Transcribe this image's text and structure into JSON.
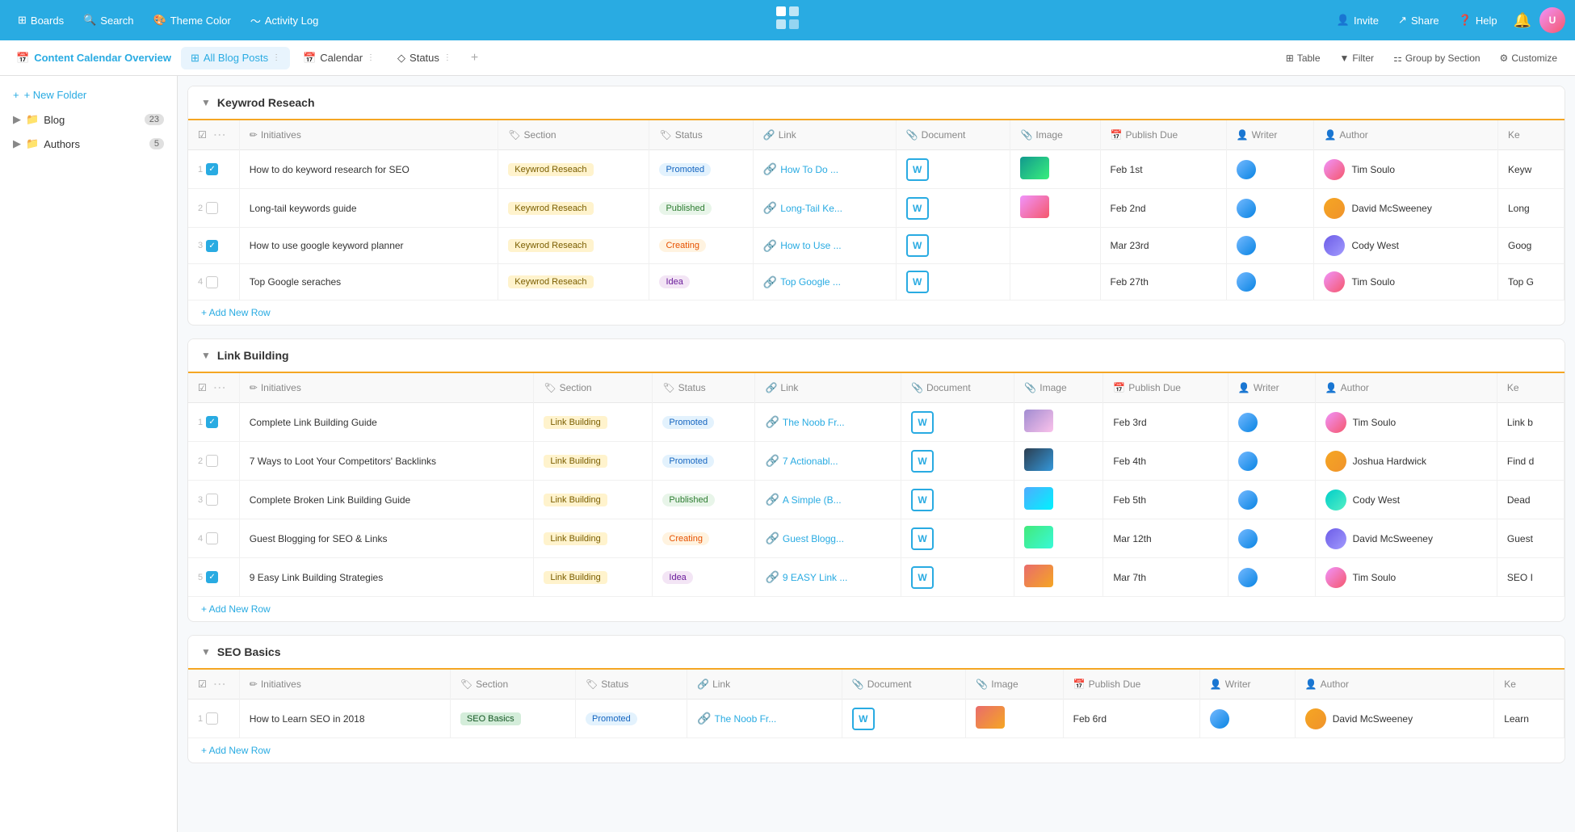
{
  "nav": {
    "boards_label": "Boards",
    "search_label": "Search",
    "theme_label": "Theme Color",
    "activity_label": "Activity Log",
    "invite_label": "Invite",
    "share_label": "Share",
    "help_label": "Help",
    "logo": "⊞"
  },
  "second_nav": {
    "page_title": "Content Calendar Overview",
    "tabs": [
      {
        "label": "All Blog Posts",
        "active": true
      },
      {
        "label": "Calendar"
      },
      {
        "label": "Status"
      }
    ],
    "tools": [
      {
        "label": "Table"
      },
      {
        "label": "Filter"
      },
      {
        "label": "Group by Section"
      },
      {
        "label": "Customize"
      }
    ]
  },
  "sidebar": {
    "new_folder": "+ New Folder",
    "items": [
      {
        "label": "Blog",
        "count": "23",
        "icon": "📁"
      },
      {
        "label": "Authors",
        "count": "5",
        "icon": "📁"
      }
    ]
  },
  "sections": [
    {
      "title": "Keywrod Reseach",
      "color": "#f5a623",
      "columns": [
        "Initiatives",
        "Section",
        "Status",
        "Link",
        "Document",
        "Image",
        "Publish Due",
        "Writer",
        "Author",
        "Ke"
      ],
      "rows": [
        {
          "num": "1",
          "checked": true,
          "initiative": "How to do keyword research for SEO",
          "section_tag": "Keywrod Reseach",
          "section_class": "tag-section",
          "status": "Promoted",
          "status_class": "status-promoted",
          "link": "How To Do ...",
          "img_class": "img-thumb-green",
          "publish_due": "Feb 1st",
          "writer_avatar": "writer-1",
          "author": "Tim Soulo",
          "author_class": "avatar-1",
          "extra": "Keyw"
        },
        {
          "num": "2",
          "checked": false,
          "initiative": "Long-tail keywords guide",
          "section_tag": "Keywrod Reseach",
          "section_class": "tag-section",
          "status": "Published",
          "status_class": "status-published",
          "link": "Long-Tail Ke...",
          "img_class": "img-thumb-orange",
          "publish_due": "Feb 2nd",
          "writer_avatar": "writer-2",
          "author": "David McSweeney",
          "author_class": "avatar-2",
          "extra": "Long"
        },
        {
          "num": "3",
          "checked": true,
          "initiative": "How to use google keyword planner",
          "section_tag": "Keywrod Reseach",
          "section_class": "tag-section",
          "status": "Creating",
          "status_class": "status-creating",
          "link": "How to Use ...",
          "img_class": "",
          "publish_due": "Mar 23rd",
          "writer_avatar": "writer-3",
          "author": "Cody West",
          "author_class": "avatar-3",
          "extra": "Goog"
        },
        {
          "num": "4",
          "checked": false,
          "initiative": "Top Google seraches",
          "section_tag": "Keywrod Reseach",
          "section_class": "tag-section",
          "status": "Idea",
          "status_class": "status-idea",
          "link": "Top Google ...",
          "img_class": "",
          "publish_due": "Feb 27th",
          "writer_avatar": "writer-1",
          "author": "Tim Soulo",
          "author_class": "avatar-1",
          "extra": "Top G"
        }
      ],
      "add_row": "+ Add New Row"
    },
    {
      "title": "Link Building",
      "color": "#f5a623",
      "columns": [
        "Initiatives",
        "Section",
        "Status",
        "Link",
        "Document",
        "Image",
        "Publish Due",
        "Writer",
        "Author",
        "Ke"
      ],
      "rows": [
        {
          "num": "1",
          "checked": true,
          "initiative": "Complete Link Building Guide",
          "section_tag": "Link Building",
          "section_class": "tag-link-building",
          "status": "Promoted",
          "status_class": "status-promoted",
          "link": "The Noob Fr...",
          "img_class": "img-thumb-purple",
          "publish_due": "Feb 3rd",
          "writer_avatar": "writer-1",
          "author": "Tim Soulo",
          "author_class": "avatar-1",
          "extra": "Link b"
        },
        {
          "num": "2",
          "checked": false,
          "initiative": "7 Ways to Loot Your Competitors' Backlinks",
          "section_tag": "Link Building",
          "section_class": "tag-link-building",
          "status": "Promoted",
          "status_class": "status-promoted",
          "link": "7 Actionabl...",
          "img_class": "img-thumb-dark",
          "publish_due": "Feb 4th",
          "writer_avatar": "writer-2",
          "author": "Joshua Hardwick",
          "author_class": "avatar-2",
          "extra": "Find d"
        },
        {
          "num": "3",
          "checked": false,
          "initiative": "Complete Broken Link Building Guide",
          "section_tag": "Link Building",
          "section_class": "tag-link-building",
          "status": "Published",
          "status_class": "status-published",
          "link": "A Simple (B...",
          "img_class": "img-thumb-blue",
          "publish_due": "Feb 5th",
          "writer_avatar": "writer-3",
          "author": "Cody West",
          "author_class": "avatar-4",
          "extra": "Dead"
        },
        {
          "num": "4",
          "checked": false,
          "initiative": "Guest Blogging for SEO & Links",
          "section_tag": "Link Building",
          "section_class": "tag-link-building",
          "status": "Creating",
          "status_class": "status-creating",
          "link": "Guest Blogg...",
          "img_class": "img-thumb-teal",
          "publish_due": "Mar 12th",
          "writer_avatar": "writer-4",
          "author": "David McSweeney",
          "author_class": "avatar-3",
          "extra": "Guest"
        },
        {
          "num": "5",
          "checked": true,
          "initiative": "9 Easy Link Building Strategies",
          "section_tag": "Link Building",
          "section_class": "tag-link-building",
          "status": "Idea",
          "status_class": "status-idea",
          "link": "9 EASY Link ...",
          "img_class": "img-thumb-red",
          "publish_due": "Mar 7th",
          "writer_avatar": "writer-1",
          "author": "Tim Soulo",
          "author_class": "avatar-1",
          "extra": "SEO I"
        }
      ],
      "add_row": "+ Add New Row"
    },
    {
      "title": "SEO Basics",
      "color": "#f5a623",
      "columns": [
        "Initiatives",
        "Section",
        "Status",
        "Link",
        "Document",
        "Image",
        "Publish Due",
        "Writer",
        "Author",
        "Ke"
      ],
      "rows": [
        {
          "num": "1",
          "checked": false,
          "initiative": "How to Learn SEO in 2018",
          "section_tag": "SEO Basics",
          "section_class": "tag-seo-basics",
          "status": "Promoted",
          "status_class": "status-promoted",
          "link": "The Noob Fr...",
          "img_class": "img-thumb-red",
          "publish_due": "Feb 6rd",
          "writer_avatar": "writer-2",
          "author": "David McSweeney",
          "author_class": "avatar-2",
          "extra": "Learn"
        }
      ],
      "add_row": "+ Add New Row"
    }
  ]
}
